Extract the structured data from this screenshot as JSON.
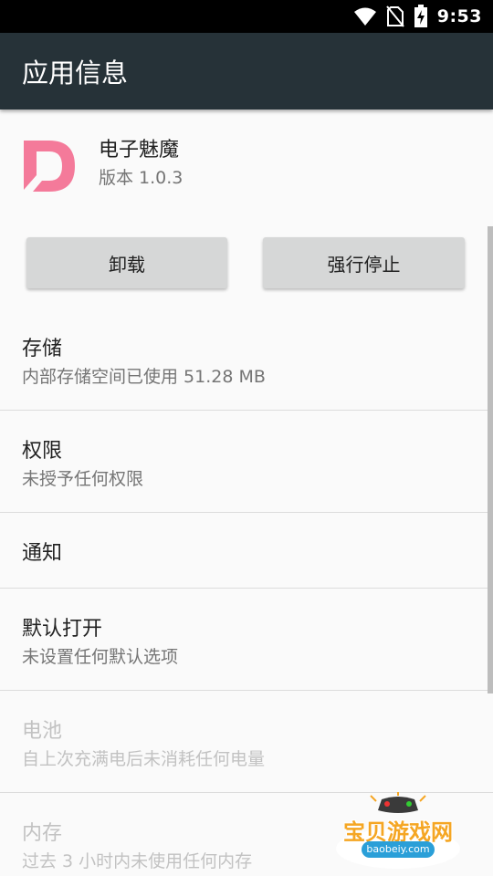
{
  "status_bar": {
    "time": "9:53",
    "icons": [
      "wifi-icon",
      "no-sim-icon",
      "battery-charging-icon"
    ]
  },
  "app_bar": {
    "title": "应用信息"
  },
  "app": {
    "name": "电子魅魔",
    "version": "版本 1.0.3",
    "icon": "app-logo-icon",
    "brand_color": "#f47a9a"
  },
  "buttons": {
    "uninstall": "卸载",
    "force_stop": "强行停止"
  },
  "sections": {
    "storage": {
      "title": "存储",
      "subtitle": "内部存储空间已使用 51.28 MB"
    },
    "permissions": {
      "title": "权限",
      "subtitle": "未授予任何权限"
    },
    "notifications": {
      "title": "通知"
    },
    "open_by_default": {
      "title": "默认打开",
      "subtitle": "未设置任何默认选项"
    },
    "battery": {
      "title": "电池",
      "subtitle": "自上次充满电后未消耗任何电量"
    },
    "memory": {
      "title": "内存",
      "subtitle": "过去 3 小时内未使用任何内存"
    }
  },
  "watermark": {
    "title": "宝贝游戏网",
    "url": "baobeiy.com"
  }
}
